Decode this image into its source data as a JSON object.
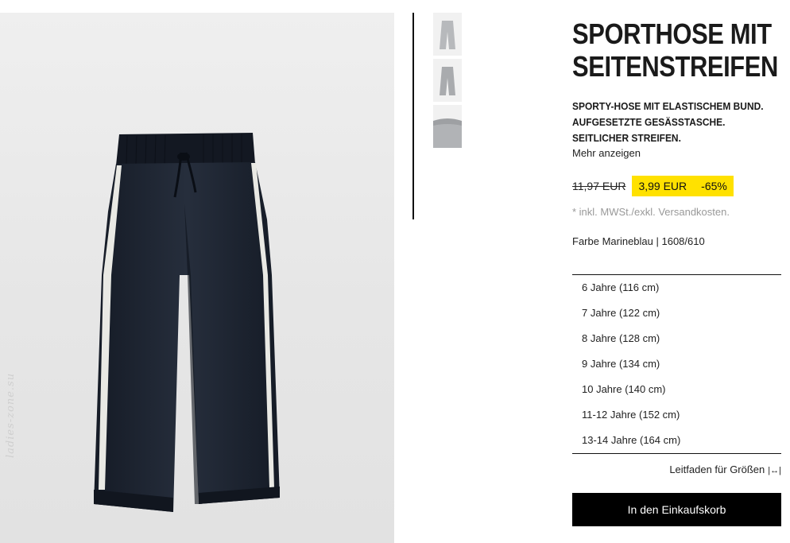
{
  "product": {
    "title_line1": "SPORTHOSE MIT",
    "title_line2": "SEITENSTREIFEN",
    "description": [
      "SPORTY-HOSE MIT ELASTISCHEM BUND.",
      "AUFGESETZTE GESÄSSTASCHE.",
      "SEITLICHER STREIFEN."
    ],
    "more_link": "Mehr anzeigen",
    "old_price": "11,97 EUR",
    "new_price": "3,99 EUR",
    "discount": "-65%",
    "tax_note": "* inkl. MWSt./exkl. Versandkosten.",
    "color_info": "Farbe Marineblau | 1608/610"
  },
  "sizes": [
    "6 Jahre (116 cm)",
    "7 Jahre (122 cm)",
    "8 Jahre (128 cm)",
    "9 Jahre (134 cm)",
    "10 Jahre (140 cm)",
    "11-12 Jahre (152 cm)",
    "13-14 Jahre (164 cm)"
  ],
  "size_guide": "Leitfaden für Größen",
  "cart_button": "In den Einkaufskorb",
  "watermark": "ladies-zone.su",
  "icons": {
    "size_guide": "ruler-icon"
  },
  "colors": {
    "sale_highlight": "#ffe100",
    "pants": "#1f2633",
    "button": "#000000"
  }
}
